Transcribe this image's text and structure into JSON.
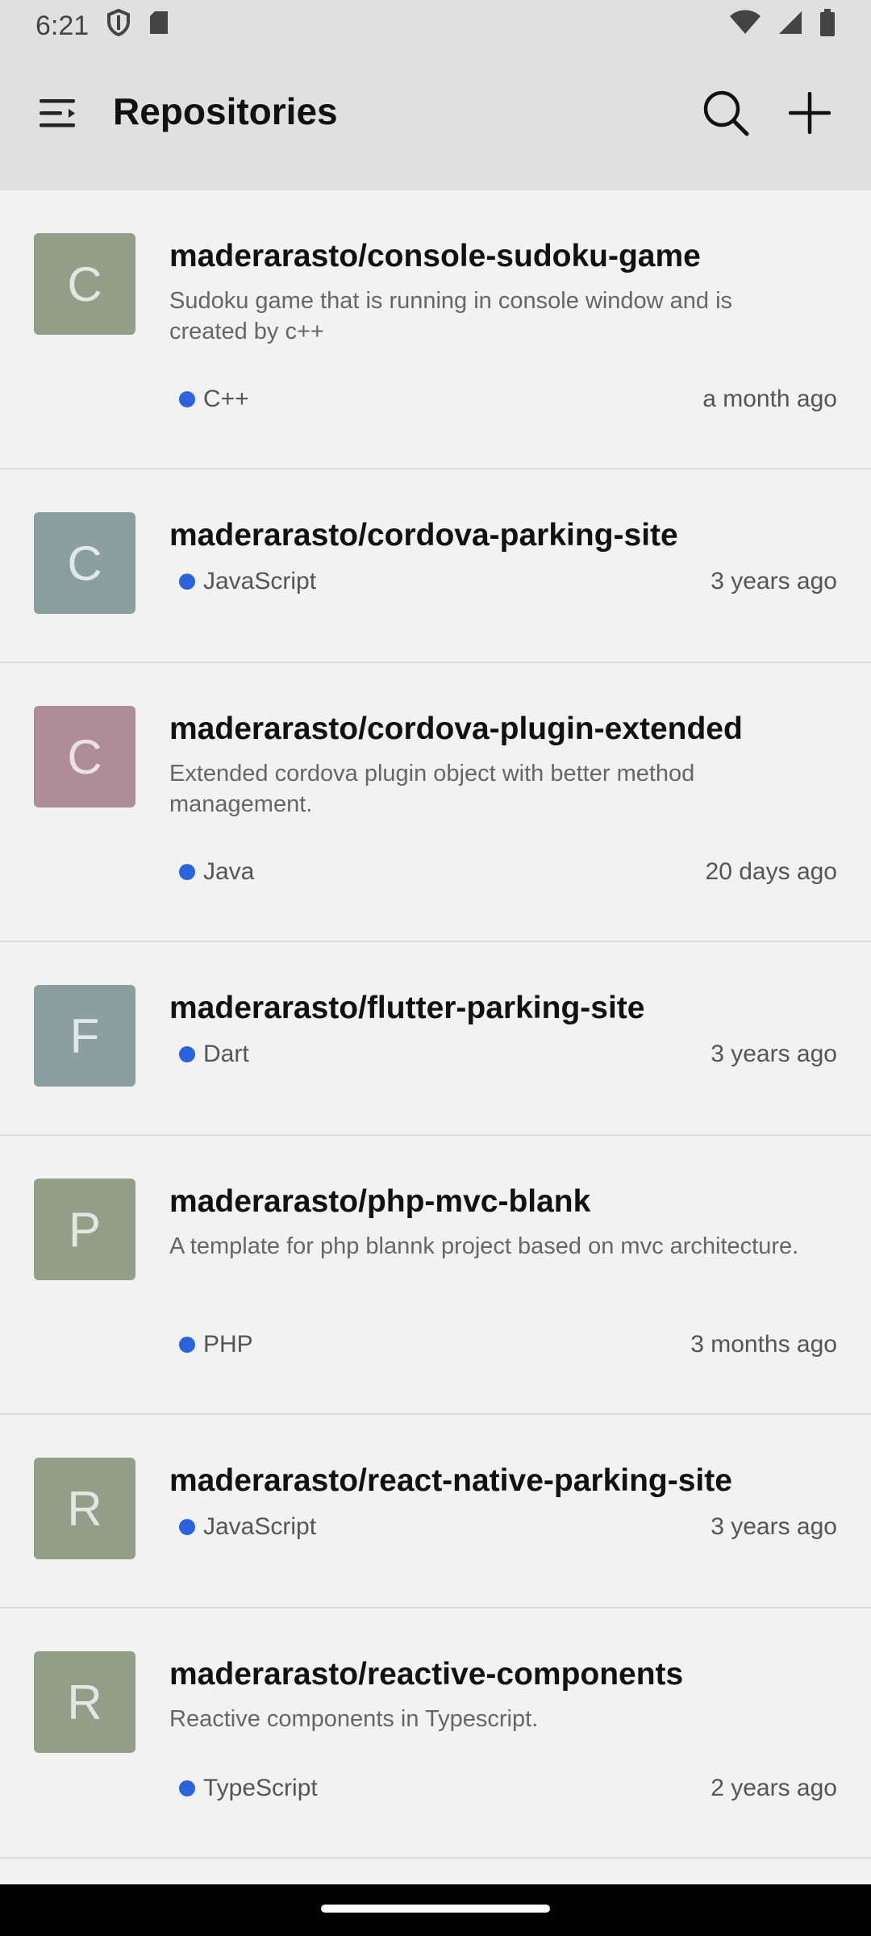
{
  "status": {
    "time": "6:21"
  },
  "app_bar": {
    "title": "Repositories"
  },
  "repos": [
    {
      "letter": "C",
      "color": "#939e89",
      "name": "maderarasto/console-sudoku-game",
      "desc": "Sudoku game that is running in console window and is created by c++",
      "lang": "C++",
      "time": "a month ago"
    },
    {
      "letter": "C",
      "color": "#8b9f9e",
      "name": "maderarasto/cordova-parking-site",
      "desc": "",
      "lang": "JavaScript",
      "time": "3 years ago"
    },
    {
      "letter": "C",
      "color": "#ae8c98",
      "name": "maderarasto/cordova-plugin-extended",
      "desc": "Extended cordova plugin object with better method management.",
      "lang": "Java",
      "time": "20 days ago"
    },
    {
      "letter": "F",
      "color": "#8b9f9e",
      "name": "maderarasto/flutter-parking-site",
      "desc": "",
      "lang": "Dart",
      "time": "3 years ago"
    },
    {
      "letter": "P",
      "color": "#939e89",
      "name": "maderarasto/php-mvc-blank",
      "desc": "A template for php blannk project based on mvc architecture.",
      "lang": "PHP",
      "time": "3 months ago"
    },
    {
      "letter": "R",
      "color": "#939e89",
      "name": "maderarasto/react-native-parking-site",
      "desc": "",
      "lang": "JavaScript",
      "time": "3 years ago"
    },
    {
      "letter": "R",
      "color": "#939e89",
      "name": "maderarasto/reactive-components",
      "desc": "Reactive components in Typescript.",
      "lang": "TypeScript",
      "time": "2 years ago"
    }
  ],
  "lang_dot_color": "#2b62e0"
}
